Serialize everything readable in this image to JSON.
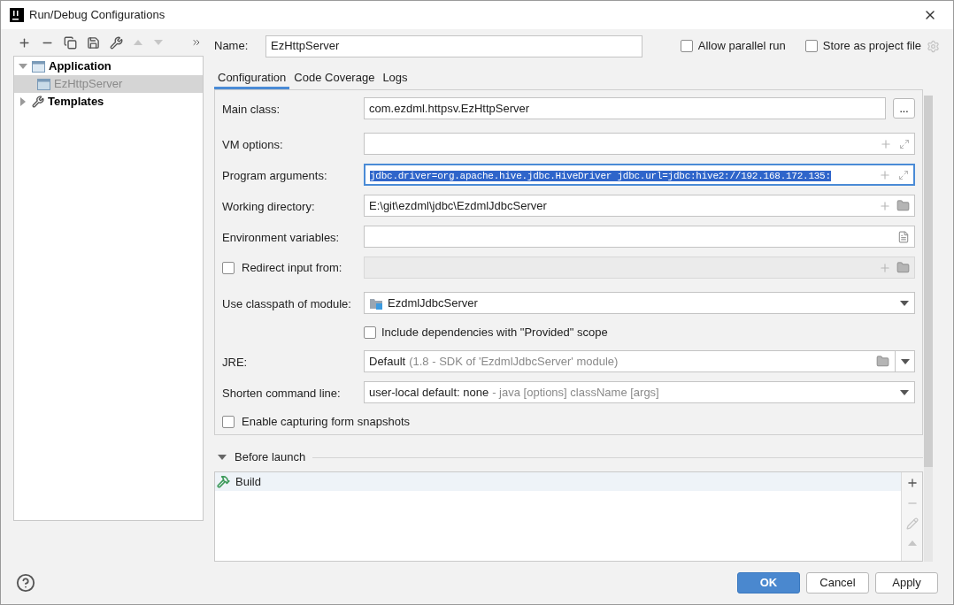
{
  "window": {
    "title": "Run/Debug Configurations"
  },
  "toolbar": [
    {
      "kind": "add",
      "disabled": false
    },
    {
      "kind": "remove",
      "disabled": false
    },
    {
      "kind": "copy",
      "disabled": false
    },
    {
      "kind": "save",
      "disabled": false
    },
    {
      "kind": "wrench",
      "disabled": false
    },
    {
      "kind": "up",
      "disabled": true
    },
    {
      "kind": "down",
      "disabled": true
    },
    {
      "kind": "more",
      "disabled": false
    }
  ],
  "tree": [
    {
      "label": "Application",
      "expanded": true,
      "selected": false,
      "kind": "application",
      "children": [
        {
          "label": "EzHttpServer",
          "selected": true,
          "kind": "config"
        }
      ]
    },
    {
      "label": "Templates",
      "expanded": false,
      "selected": false,
      "kind": "templates"
    }
  ],
  "name": {
    "label": "Name:",
    "value": "EzHttpServer"
  },
  "options": [
    {
      "label": "Allow parallel run",
      "checked": false
    },
    {
      "label": "Store as project file",
      "checked": false
    }
  ],
  "tabs": [
    {
      "label": "Configuration",
      "selected": true
    },
    {
      "label": "Code Coverage",
      "selected": false
    },
    {
      "label": "Logs",
      "selected": false
    }
  ],
  "form": [
    {
      "kind": "browse",
      "label": "Main class:",
      "value": "com.ezdml.httpsv.EzHttpServer",
      "button": "..."
    },
    {
      "kind": "expandable",
      "label": "VM options:",
      "selected": false
    },
    {
      "kind": "expandable",
      "label": "Program arguments:",
      "value": "jdbc.driver=org.apache.hive.jdbc.HiveDriver jdbc.url=jdbc:hive2://192.168.172.135:",
      "selected": true
    },
    {
      "kind": "directory",
      "label": "Working directory:",
      "value": "E:\\git\\ezdml\\jdbc\\EzdmlJdbcServer"
    },
    {
      "kind": "document",
      "label": "Environment variables:"
    },
    {
      "kind": "checkbox-directory",
      "label": "Redirect input from:",
      "checked": false,
      "disabled": true
    },
    {
      "kind": "module",
      "label": "Use classpath of module:",
      "value": "EzdmlJdbcServer"
    },
    {
      "kind": "sub-checkbox",
      "label": "Include dependencies with \"Provided\" scope",
      "checked": false
    },
    {
      "kind": "jre",
      "label": "JRE:",
      "value": "Default",
      "hint": "(1.8 - SDK of 'EzdmlJdbcServer' module)"
    },
    {
      "kind": "dropdown",
      "label": "Shorten command line:",
      "value": "user-local default: none",
      "hint": "- java [options] className [args]"
    },
    {
      "kind": "checkbox",
      "label": "Enable capturing form snapshots",
      "checked": false
    }
  ],
  "before_launch": {
    "title": "Before launch",
    "expanded": true,
    "items": [
      {
        "label": "Build",
        "selected": true
      }
    ],
    "actions": [
      {
        "kind": "add",
        "disabled": false
      },
      {
        "kind": "remove",
        "disabled": true
      },
      {
        "kind": "edit",
        "disabled": true
      },
      {
        "kind": "up",
        "disabled": true
      }
    ]
  },
  "buttons": [
    {
      "label": "OK",
      "kind": "primary"
    },
    {
      "label": "Cancel",
      "kind": "normal"
    },
    {
      "label": "Apply",
      "kind": "normal"
    }
  ]
}
